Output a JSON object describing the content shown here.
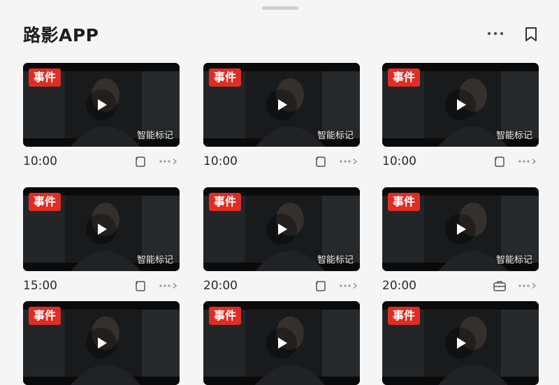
{
  "header": {
    "title": "路影APP",
    "more_icon": "more-horizontal-icon",
    "bookmark_icon": "bookmark-icon"
  },
  "colors": {
    "event_tag": "#e02d24",
    "background": "#f5f5f5"
  },
  "videos": [
    {
      "tag": "事件",
      "mark": "智能标记",
      "time": "10:00",
      "action_icon": "copy-icon"
    },
    {
      "tag": "事件",
      "mark": "智能标记",
      "time": "10:00",
      "action_icon": "copy-icon"
    },
    {
      "tag": "事件",
      "mark": "智能标记",
      "time": "10:00",
      "action_icon": "copy-icon"
    },
    {
      "tag": "事件",
      "mark": "智能标记",
      "time": "15:00",
      "action_icon": "copy-icon"
    },
    {
      "tag": "事件",
      "mark": "智能标记",
      "time": "20:00",
      "action_icon": "copy-icon"
    },
    {
      "tag": "事件",
      "mark": "智能标记",
      "time": "20:00",
      "action_icon": "briefcase-icon"
    },
    {
      "tag": "事件",
      "mark": "",
      "time": "",
      "action_icon": ""
    },
    {
      "tag": "事件",
      "mark": "",
      "time": "",
      "action_icon": ""
    },
    {
      "tag": "事件",
      "mark": "",
      "time": "",
      "action_icon": ""
    }
  ]
}
